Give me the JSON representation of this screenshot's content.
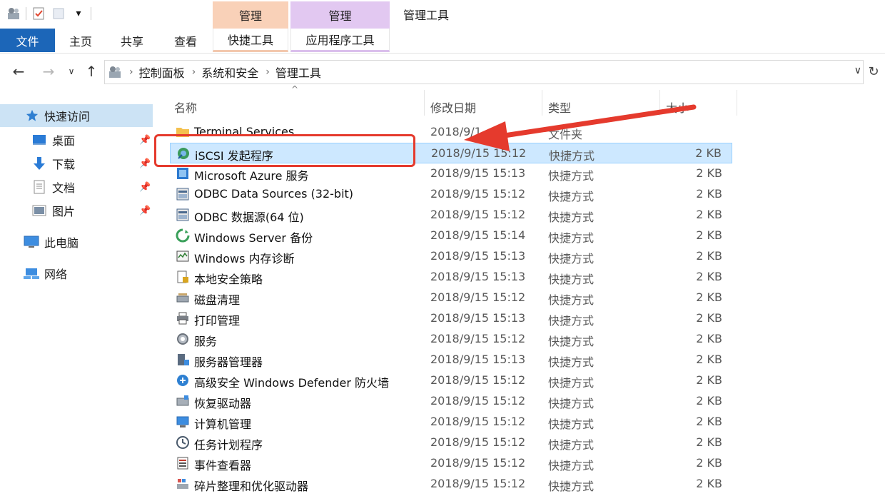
{
  "ribbon": {
    "context_groups": [
      "管理",
      "管理"
    ],
    "window_title": "管理工具",
    "tabs": {
      "file": "文件",
      "home": "主页",
      "share": "共享",
      "view": "查看",
      "shortcut_tools": "快捷工具",
      "app_tools": "应用程序工具"
    },
    "accent_color": "#1c66b8"
  },
  "address": {
    "breadcrumbs": [
      "控制面板",
      "系统和安全",
      "管理工具"
    ]
  },
  "sidebar": {
    "items": [
      {
        "label": "快速访问",
        "icon": "star-icon",
        "selected": true
      },
      {
        "label": "桌面",
        "icon": "desktop-icon",
        "pinned": true
      },
      {
        "label": "下载",
        "icon": "download-icon",
        "pinned": true
      },
      {
        "label": "文档",
        "icon": "document-icon",
        "pinned": true
      },
      {
        "label": "图片",
        "icon": "picture-icon",
        "pinned": true
      },
      {
        "label": "此电脑",
        "icon": "computer-icon"
      },
      {
        "label": "网络",
        "icon": "network-icon"
      }
    ]
  },
  "columns": {
    "name": "名称",
    "date": "修改日期",
    "type": "类型",
    "size": "大小"
  },
  "files": [
    {
      "name": "Terminal Services",
      "date": "2018/9/1…",
      "type": "文件夹",
      "size": "",
      "icon": "folder-icon"
    },
    {
      "name": "iSCSI 发起程序",
      "date": "2018/9/15 15:12",
      "type": "快捷方式",
      "size": "2 KB",
      "icon": "iscsi-icon",
      "selected": true
    },
    {
      "name": "Microsoft Azure 服务",
      "date": "2018/9/15 15:13",
      "type": "快捷方式",
      "size": "2 KB",
      "icon": "azure-icon"
    },
    {
      "name": "ODBC Data Sources (32-bit)",
      "date": "2018/9/15 15:12",
      "type": "快捷方式",
      "size": "2 KB",
      "icon": "odbc-icon"
    },
    {
      "name": "ODBC 数据源(64 位)",
      "date": "2018/9/15 15:12",
      "type": "快捷方式",
      "size": "2 KB",
      "icon": "odbc-icon"
    },
    {
      "name": "Windows Server 备份",
      "date": "2018/9/15 15:14",
      "type": "快捷方式",
      "size": "2 KB",
      "icon": "backup-icon"
    },
    {
      "name": "Windows 内存诊断",
      "date": "2018/9/15 15:13",
      "type": "快捷方式",
      "size": "2 KB",
      "icon": "memory-icon"
    },
    {
      "name": "本地安全策略",
      "date": "2018/9/15 15:13",
      "type": "快捷方式",
      "size": "2 KB",
      "icon": "security-policy-icon"
    },
    {
      "name": "磁盘清理",
      "date": "2018/9/15 15:12",
      "type": "快捷方式",
      "size": "2 KB",
      "icon": "disk-cleanup-icon"
    },
    {
      "name": "打印管理",
      "date": "2018/9/15 15:13",
      "type": "快捷方式",
      "size": "2 KB",
      "icon": "printer-icon"
    },
    {
      "name": "服务",
      "date": "2018/9/15 15:12",
      "type": "快捷方式",
      "size": "2 KB",
      "icon": "services-icon"
    },
    {
      "name": "服务器管理器",
      "date": "2018/9/15 15:13",
      "type": "快捷方式",
      "size": "2 KB",
      "icon": "server-manager-icon"
    },
    {
      "name": "高级安全 Windows Defender 防火墙",
      "date": "2018/9/15 15:12",
      "type": "快捷方式",
      "size": "2 KB",
      "icon": "firewall-icon"
    },
    {
      "name": "恢复驱动器",
      "date": "2018/9/15 15:12",
      "type": "快捷方式",
      "size": "2 KB",
      "icon": "recovery-drive-icon"
    },
    {
      "name": "计算机管理",
      "date": "2018/9/15 15:12",
      "type": "快捷方式",
      "size": "2 KB",
      "icon": "computer-management-icon"
    },
    {
      "name": "任务计划程序",
      "date": "2018/9/15 15:12",
      "type": "快捷方式",
      "size": "2 KB",
      "icon": "task-scheduler-icon"
    },
    {
      "name": "事件查看器",
      "date": "2018/9/15 15:12",
      "type": "快捷方式",
      "size": "2 KB",
      "icon": "event-viewer-icon"
    },
    {
      "name": "碎片整理和优化驱动器",
      "date": "2018/9/15 15:12",
      "type": "快捷方式",
      "size": "2 KB",
      "icon": "defrag-icon"
    }
  ],
  "annotation": {
    "highlight_color": "#e53a2d"
  }
}
